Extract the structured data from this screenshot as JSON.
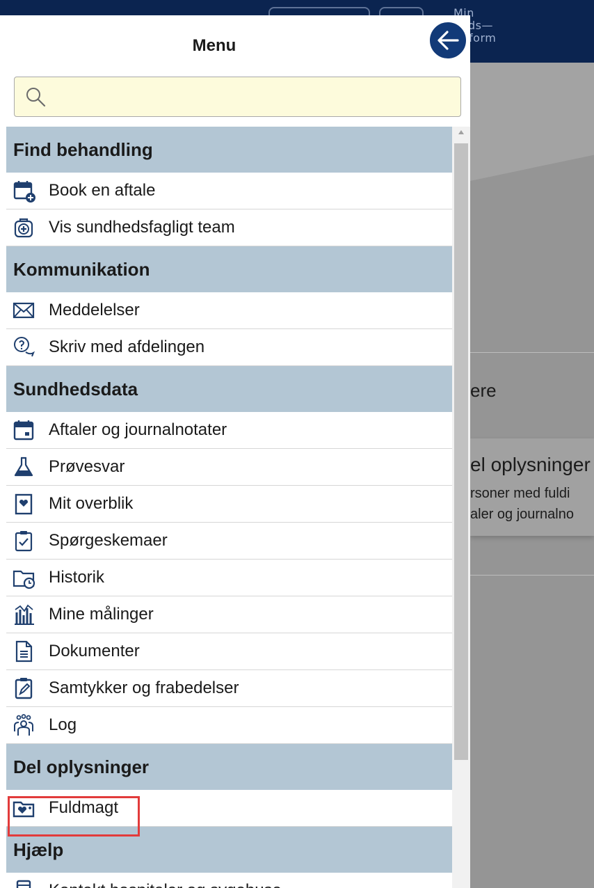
{
  "background": {
    "logo_lines": [
      "Min",
      "heds—",
      "latform"
    ],
    "section_title": "ere",
    "card_title": "el oplysninger",
    "card_line1": "rsoner med fuldi",
    "card_line2": "aler og journalno"
  },
  "menu": {
    "title": "Menu",
    "search_placeholder": "",
    "sections": [
      {
        "label": "Find behandling",
        "items": [
          {
            "label": "Book en aftale",
            "icon": "calendar-add-icon"
          },
          {
            "label": "Vis sundhedsfagligt team",
            "icon": "medical-bag-icon"
          }
        ]
      },
      {
        "label": "Kommunikation",
        "items": [
          {
            "label": "Meddelelser",
            "icon": "envelope-icon"
          },
          {
            "label": "Skriv med afdelingen",
            "icon": "chat-question-icon"
          }
        ]
      },
      {
        "label": "Sundhedsdata",
        "items": [
          {
            "label": "Aftaler og journalnotater",
            "icon": "calendar-icon"
          },
          {
            "label": "Prøvesvar",
            "icon": "flask-icon"
          },
          {
            "label": "Mit overblik",
            "icon": "heart-card-icon"
          },
          {
            "label": "Spørgeskemaer",
            "icon": "clipboard-check-icon"
          },
          {
            "label": "Historik",
            "icon": "folder-clock-icon"
          },
          {
            "label": "Mine målinger",
            "icon": "measurements-chart-icon"
          },
          {
            "label": "Dokumenter",
            "icon": "document-icon"
          },
          {
            "label": "Samtykker og frabedelser",
            "icon": "consent-pen-icon"
          },
          {
            "label": "Log",
            "icon": "people-group-icon"
          }
        ]
      },
      {
        "label": "Del oplysninger",
        "items": [
          {
            "label": "Fuldmagt",
            "icon": "folder-heart-icon"
          }
        ]
      },
      {
        "label": "Hjælp",
        "items": [
          {
            "label": "Kontakt hospitaler og sygehuse",
            "icon": "hospital-phone-icon"
          }
        ]
      }
    ]
  },
  "colors": {
    "accent": "#123a78",
    "section_bg": "#b3c6d4",
    "highlight": "#e23b3b",
    "search_bg": "#fdfbdc"
  }
}
